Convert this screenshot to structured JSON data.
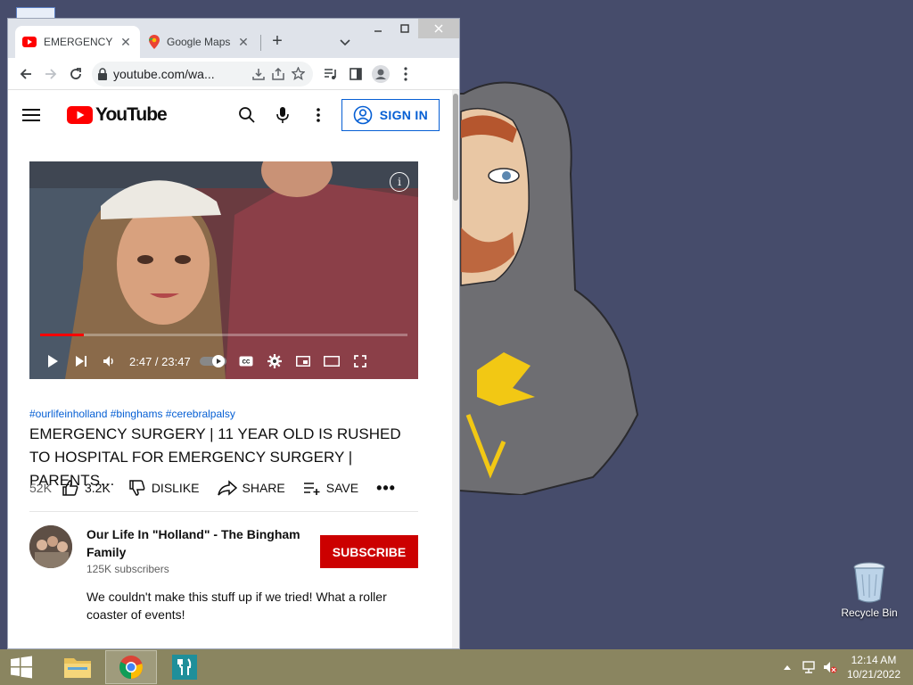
{
  "browser": {
    "tabs": [
      {
        "label": "EMERGENCY",
        "close": "✕",
        "active": true
      },
      {
        "label": "Google Maps",
        "close": "✕",
        "active": false
      }
    ],
    "new_tab": "+",
    "url": "youtube.com/wa..."
  },
  "youtube": {
    "logo_text": "YouTube",
    "sign_in_label": "SIGN IN",
    "player": {
      "time": "2:47 / 23:47",
      "progress_fraction": 0.12,
      "info_label": "i"
    },
    "hashtags": "#ourlifeinholland #binghams #cerebralpalsy",
    "title": "EMERGENCY SURGERY | 11 YEAR OLD IS RUSHED TO HOSPITAL FOR EMERGENCY SURGERY | PARENTS…",
    "views": "52K",
    "likes": "3.2K",
    "dislike_label": "DISLIKE",
    "share_label": "SHARE",
    "save_label": "SAVE",
    "more_label": "•••",
    "channel": {
      "name": "Our Life In \"Holland\" - The Bingham Family",
      "subscribers": "125K subscribers",
      "subscribe_label": "SUBSCRIBE",
      "description": "We couldn't make this stuff up if we tried! What a roller coaster of events!"
    }
  },
  "desktop": {
    "recycle_bin_label": "Recycle Bin"
  },
  "taskbar": {
    "apps": [
      "file-explorer",
      "chrome",
      "restaurant-app"
    ],
    "time": "12:14 AM",
    "date": "10/21/2022"
  },
  "colors": {
    "youtube_red": "#ff0000",
    "subscribe_red": "#cc0000",
    "link_blue": "#065fd4",
    "desktop_bg": "#464c6b",
    "taskbar": "#8a8560"
  }
}
